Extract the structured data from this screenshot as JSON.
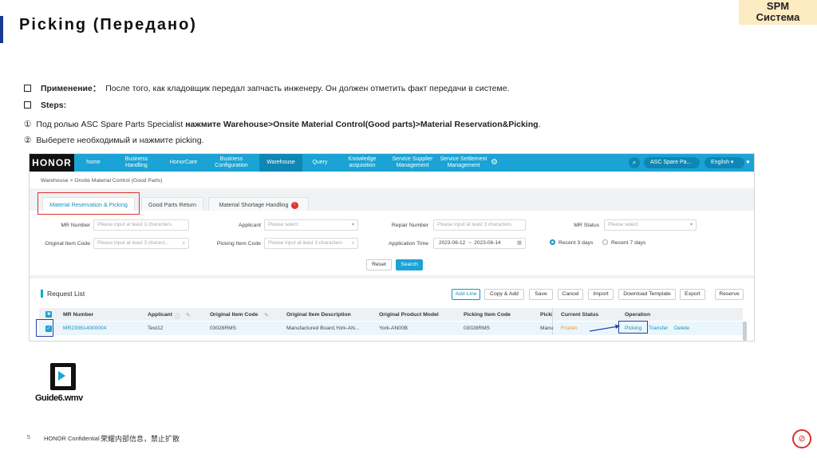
{
  "slide": {
    "title": "Picking (Передано)",
    "badge_line1": "SPM",
    "badge_line2": "Система",
    "accent_color": "#1a3a8f",
    "bullets": {
      "usage_label": "Применение：",
      "usage_text": "После того, как кладовщик передал запчасть инженеру. Он должен отметить факт передачи в системе.",
      "steps_label": "Steps:",
      "step1_num": "①",
      "step1_prefix": "Под ролью ASC Spare Parts Specialist ",
      "step1_bold": "нажмите Warehouse>Onsite Material Control(Good parts)>Material Reservation&Picking",
      "step1_suffix": ".",
      "step2_num": "②",
      "step2_text": "Выберете необходимый и нажмите picking."
    },
    "attachment_name": "Guide6.wmv",
    "page_number": "5",
    "footer_text": "HONOR Confidential",
    "footer_cn": "荣耀内部信息，禁止扩散",
    "no_copy_icon": "no-copy-icon"
  },
  "app": {
    "logo": "HONOR",
    "nav": [
      {
        "label": "home"
      },
      {
        "label": "Business Handling"
      },
      {
        "label": "HonorCare"
      },
      {
        "label": "Business Configuration"
      },
      {
        "label": "Warehouse"
      },
      {
        "label": "Query"
      },
      {
        "label": "Knowledge acquisition"
      },
      {
        "label": "Service Supplier Management"
      },
      {
        "label": "Service Settlement Management"
      }
    ],
    "user_menu": "ASC Spare Pa... ▾",
    "language": "English ▾",
    "breadcrumb": "Warehouse  >  Onsite Material Control (Good Parts)",
    "tabs": [
      {
        "label": "Material Reservation & Picking"
      },
      {
        "label": "Good Parts Return"
      },
      {
        "label": "Material Shortage Handling"
      }
    ],
    "tab_badge": "!",
    "filters": {
      "mr_number_label": "MR Number",
      "mr_number_ph": "Please input at least 3 characters",
      "applicant_label": "Applicant",
      "applicant_ph": "Please select",
      "repair_label": "Repair Number",
      "repair_ph": "Please input at least 3 characters",
      "status_label": "MR Status",
      "status_ph": "Please select",
      "orig_label": "Original Item Code",
      "orig_ph": "Please input at least 3 charact...",
      "pick_label": "Picking Item Code",
      "pick_ph": "Please input at least 3 characters",
      "date_label": "Application Time",
      "date_from": "2023-06-12",
      "date_sep": "~",
      "date_to": "2023-06-14",
      "recent3": "Recent 3 days",
      "recent7": "Recent 7 days"
    },
    "reset_label": "Reset",
    "search_label": "Search",
    "request_list_title": "Request List",
    "toolbar": {
      "add_line": "Add Line",
      "copy_add": "Copy & Add",
      "save": "Save",
      "cancel": "Cancel",
      "import": "Import",
      "download": "Download Template",
      "export": "Export",
      "reserve": "Reserve"
    },
    "table": {
      "headers": [
        "MR Number",
        "Applicant",
        "Original Item Code",
        "Original Item Description",
        "Original Product Model",
        "Picking Item Code",
        "Picki",
        "Current Status",
        "Operation"
      ],
      "row": {
        "mr": "MR230614000004",
        "applicant": "Test12",
        "orig_code": "03028RMS",
        "orig_desc": "Manufactured Board,York-AN...",
        "model": "York-AN00B",
        "pick_code": "03028RMS",
        "picki": "Manu",
        "status": "Frozen",
        "op_picking": "Picking",
        "op_transfer": "Transfer",
        "op_delete": "Delete"
      }
    }
  }
}
